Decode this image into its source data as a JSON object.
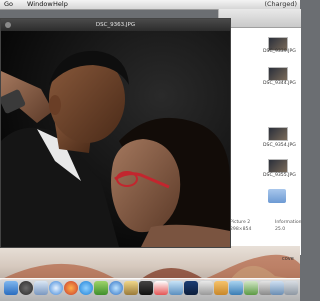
{
  "menubar": {
    "items": [
      "Go",
      "Window",
      "Help"
    ],
    "status": "(Charged)"
  },
  "quicklook": {
    "title": "DSC_9363.JPG"
  },
  "finder": {
    "files": [
      "DSC_9339.JPG",
      "DSC_9344.JPG",
      "DSC_9354.JPG",
      "DSC_9355.JPG"
    ],
    "picture_name": "Picture 2",
    "picture_size": "298×854",
    "info_label": "Information",
    "info_sublabel": "25.0",
    "desktop_label": "cove"
  },
  "dock": {
    "icons": [
      "finder-icon",
      "dashboard-icon",
      "mail-icon",
      "safari-icon",
      "firefox-icon",
      "skype-icon",
      "ichat-icon",
      "itunes-icon",
      "iphoto-icon",
      "terminal-icon",
      "calendar-icon",
      "preview-icon",
      "photoshop-icon",
      "app-icon",
      "app-icon",
      "app-icon",
      "app-icon",
      "app-icon",
      "app-icon",
      "trash-icon"
    ]
  },
  "colors": {
    "accent": "#3b84d8",
    "dock_red": "#c8382d",
    "dock_blue": "#2b6fc4"
  }
}
